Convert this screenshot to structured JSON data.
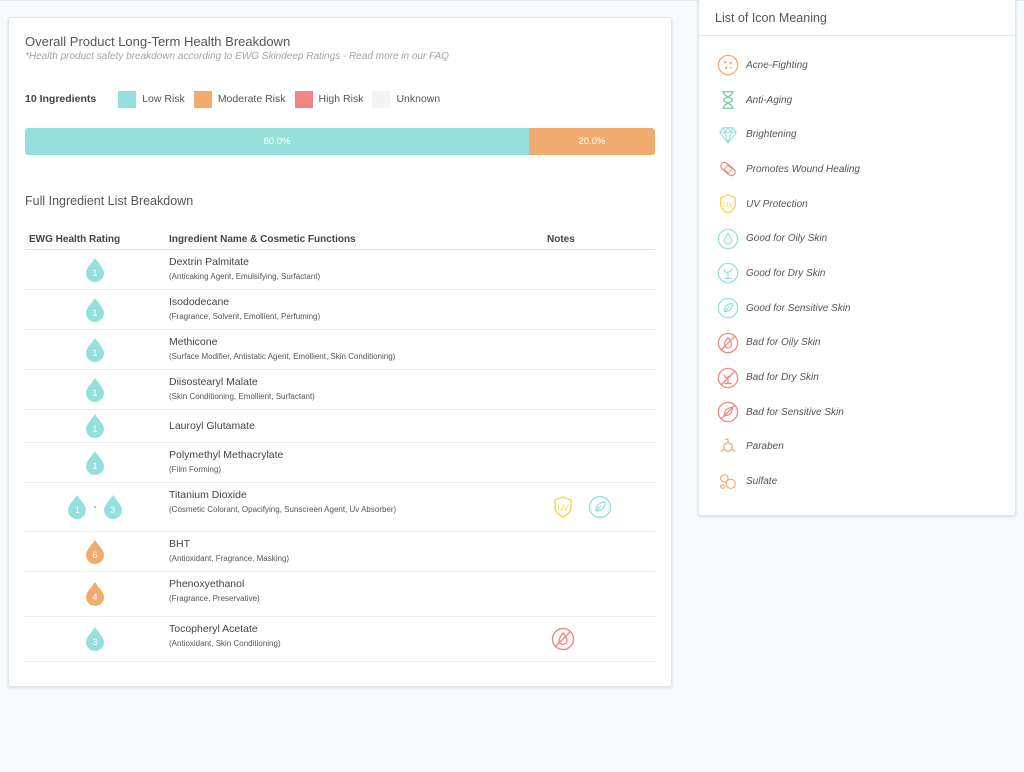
{
  "main": {
    "title": "Overall Product Long-Term Health Breakdown",
    "subtitle": "*Health product safety breakdown according to EWG Skindeep Ratings - Read more in our FAQ",
    "legend": {
      "count": "10 Ingredients",
      "items": [
        {
          "label": "Low Risk",
          "color": "#96e0dc"
        },
        {
          "label": "Moderate Risk",
          "color": "#f2ab6f"
        },
        {
          "label": "High Risk",
          "color": "#f08584"
        },
        {
          "label": "Unknown",
          "color": "#f4f4f4"
        }
      ]
    },
    "breakdown": [
      {
        "label": "80.0%",
        "value": 80.0,
        "color": "#96e0dc"
      },
      {
        "label": "20.0%",
        "value": 20.0,
        "color": "#f2ab6f"
      }
    ],
    "section_title": "Full Ingredient List Breakdown",
    "columns": {
      "rating": "EWG Health Rating",
      "ingredient": "Ingredient Name & Cosmetic Functions",
      "notes": "Notes"
    },
    "ingredients": [
      {
        "name": "Dextrin Palmitate",
        "functions": "(Anticaking Agent, Emulsifying, Surfactant)",
        "ratings": [
          "1"
        ],
        "color": "#96e0dc",
        "notes": []
      },
      {
        "name": "Isododecane",
        "functions": "(Fragrance, Solvent, Emollient, Perfuming)",
        "ratings": [
          "1"
        ],
        "color": "#96e0dc",
        "notes": []
      },
      {
        "name": "Methicone",
        "functions": "(Surface Modifier, Antistatic Agent, Emollient, Skin Conditioning)",
        "ratings": [
          "1"
        ],
        "color": "#96e0dc",
        "notes": []
      },
      {
        "name": "Diisostearyl Malate",
        "functions": "(Skin Conditioning, Emollient, Surfactant)",
        "ratings": [
          "1"
        ],
        "color": "#96e0dc",
        "notes": []
      },
      {
        "name": "Lauroyl Glutamate",
        "functions": "",
        "ratings": [
          "1"
        ],
        "color": "#96e0dc",
        "notes": []
      },
      {
        "name": "Polymethyl Methacrylate",
        "functions": "(Film Forming)",
        "ratings": [
          "1"
        ],
        "color": "#96e0dc",
        "notes": []
      },
      {
        "name": "Titanium Dioxide",
        "functions": "(Cosmetic Colorant, Opacifying, Sunscreen Agent, Uv Absorber)",
        "ratings": [
          "1",
          "3"
        ],
        "color": "#96e0dc",
        "notes": [
          "uv-protection",
          "good-sensitive"
        ]
      },
      {
        "name": "BHT",
        "functions": "(Antioxidant, Fragrance, Masking)",
        "ratings": [
          "6"
        ],
        "color": "#f2ab6f",
        "notes": []
      },
      {
        "name": "Phenoxyethanol",
        "functions": "(Fragrance, Preservative)",
        "ratings": [
          "4"
        ],
        "color": "#f2ab6f",
        "notes": []
      },
      {
        "name": "Tocopheryl Acetate",
        "functions": "(Antioxidant, Skin Conditioning)",
        "ratings": [
          "3"
        ],
        "color": "#96e0dc",
        "notes": [
          "bad-oily"
        ]
      }
    ]
  },
  "sidebar": {
    "title": "List of Icon Meaning",
    "items": [
      {
        "icon": "acne-fighting-icon",
        "label": "Acne-Fighting",
        "color": "#f2ab6f"
      },
      {
        "icon": "anti-aging-icon",
        "label": "Anti-Aging",
        "color": "#6dcf9c"
      },
      {
        "icon": "brightening-icon",
        "label": "Brightening",
        "color": "#96e0dc"
      },
      {
        "icon": "wound-healing-icon",
        "label": "Promotes Wound Healing",
        "color": "#f08584"
      },
      {
        "icon": "uv-protection-icon",
        "label": "UV Protection",
        "color": "#f5d44a"
      },
      {
        "icon": "good-oily-icon",
        "label": "Good for Oily Skin",
        "color": "#96e0dc"
      },
      {
        "icon": "good-dry-icon",
        "label": "Good for Dry Skin",
        "color": "#96e0dc"
      },
      {
        "icon": "good-sensitive-icon",
        "label": "Good for Sensitive Skin",
        "color": "#96e0dc"
      },
      {
        "icon": "bad-oily-icon",
        "label": "Bad for Oily Skin",
        "color": "#f08584"
      },
      {
        "icon": "bad-dry-icon",
        "label": "Bad for Dry Skin",
        "color": "#f08584"
      },
      {
        "icon": "bad-sensitive-icon",
        "label": "Bad for Sensitive Skin",
        "color": "#f08584"
      },
      {
        "icon": "paraben-icon",
        "label": "Paraben",
        "color": "#f2ab6f"
      },
      {
        "icon": "sulfate-icon",
        "label": "Sulfate",
        "color": "#f2ab6f"
      }
    ]
  }
}
